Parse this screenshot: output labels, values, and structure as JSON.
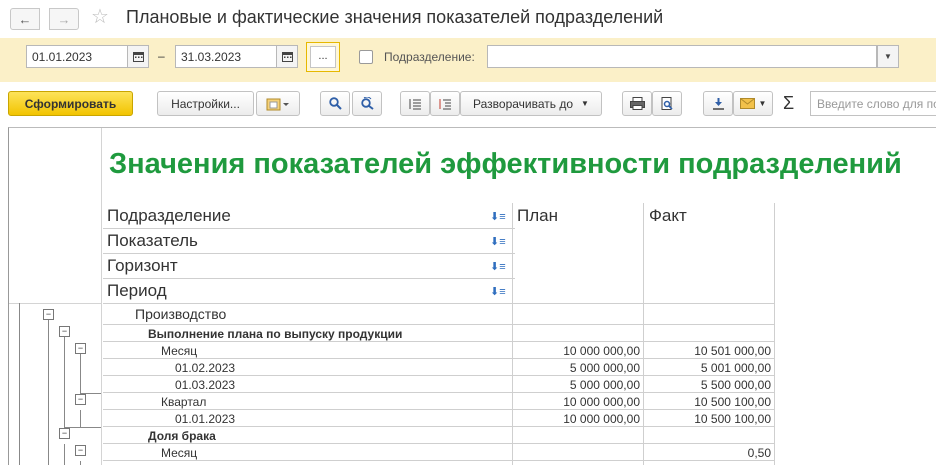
{
  "window": {
    "title": "Плановые и фактические значения показателей подразделений",
    "back_icon": "←",
    "forward_icon": "→",
    "star_icon": "☆"
  },
  "params": {
    "date_from": "01.01.2023",
    "date_to": "31.03.2023",
    "dash": "–",
    "dots_label": "...",
    "department_label": "Подразделение:",
    "department_value": ""
  },
  "toolbar": {
    "generate_label": "Сформировать",
    "settings_label": "Настройки...",
    "expand_label": "Разворачивать до",
    "sigma": "Σ",
    "search_placeholder": "Введите слово для поиска"
  },
  "report": {
    "title": "Значения показателей эффективности подразделений",
    "headers": {
      "department": "Подразделение",
      "indicator": "Показатель",
      "horizon": "Горизонт",
      "period": "Период",
      "plan": "План",
      "fact": "Факт"
    },
    "rows": [
      {
        "label": "Производство",
        "plan": "",
        "fact": ""
      },
      {
        "label": "Выполнение плана по выпуску продукции",
        "plan": "",
        "fact": ""
      },
      {
        "label": "Месяц",
        "plan": "10 000 000,00",
        "fact": "10 501 000,00"
      },
      {
        "label": "01.02.2023",
        "plan": "5 000 000,00",
        "fact": "5 001 000,00"
      },
      {
        "label": "01.03.2023",
        "plan": "5 000 000,00",
        "fact": "5 500 000,00"
      },
      {
        "label": "Квартал",
        "plan": "10 000 000,00",
        "fact": "10 500 100,00"
      },
      {
        "label": "01.01.2023",
        "plan": "10 000 000,00",
        "fact": "10 500 100,00"
      },
      {
        "label": "Доля брака",
        "plan": "",
        "fact": ""
      },
      {
        "label": "Месяц",
        "plan": "",
        "fact": "0,50"
      }
    ]
  },
  "colors": {
    "title_green": "#1f9a3e",
    "params_bg": "#fbf0c8",
    "primary_button": "#f2c400"
  }
}
